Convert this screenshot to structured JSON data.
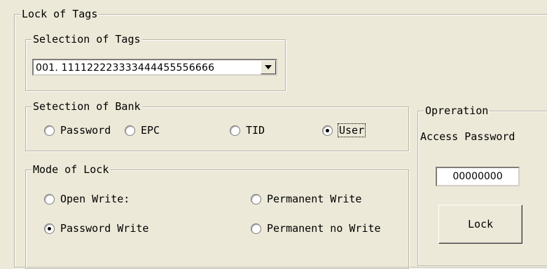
{
  "lock_group": {
    "legend": "Lock of Tags",
    "selection_group": {
      "legend": "Selection of Tags",
      "selected_tag": "001. 111122223333444455556666"
    },
    "bank_group": {
      "legend": "Setection of Bank",
      "options": [
        {
          "label": "Password",
          "checked": false
        },
        {
          "label": "EPC",
          "checked": false
        },
        {
          "label": "TID",
          "checked": false
        },
        {
          "label": "User",
          "checked": true
        }
      ]
    },
    "mode_group": {
      "legend": "Mode of Lock",
      "options": [
        {
          "label": "Open Write:",
          "checked": false
        },
        {
          "label": "Permanent Write",
          "checked": false
        },
        {
          "label": "Password Write",
          "checked": true
        },
        {
          "label": "Permanent no Write",
          "checked": false
        }
      ]
    }
  },
  "operation_group": {
    "legend": "Opreration",
    "access_password_label": "Access Password",
    "access_password_value": "00000000",
    "lock_button_label": "Lock"
  },
  "colors": {
    "background": "#ece9d8",
    "border": "#b9b6a6"
  }
}
